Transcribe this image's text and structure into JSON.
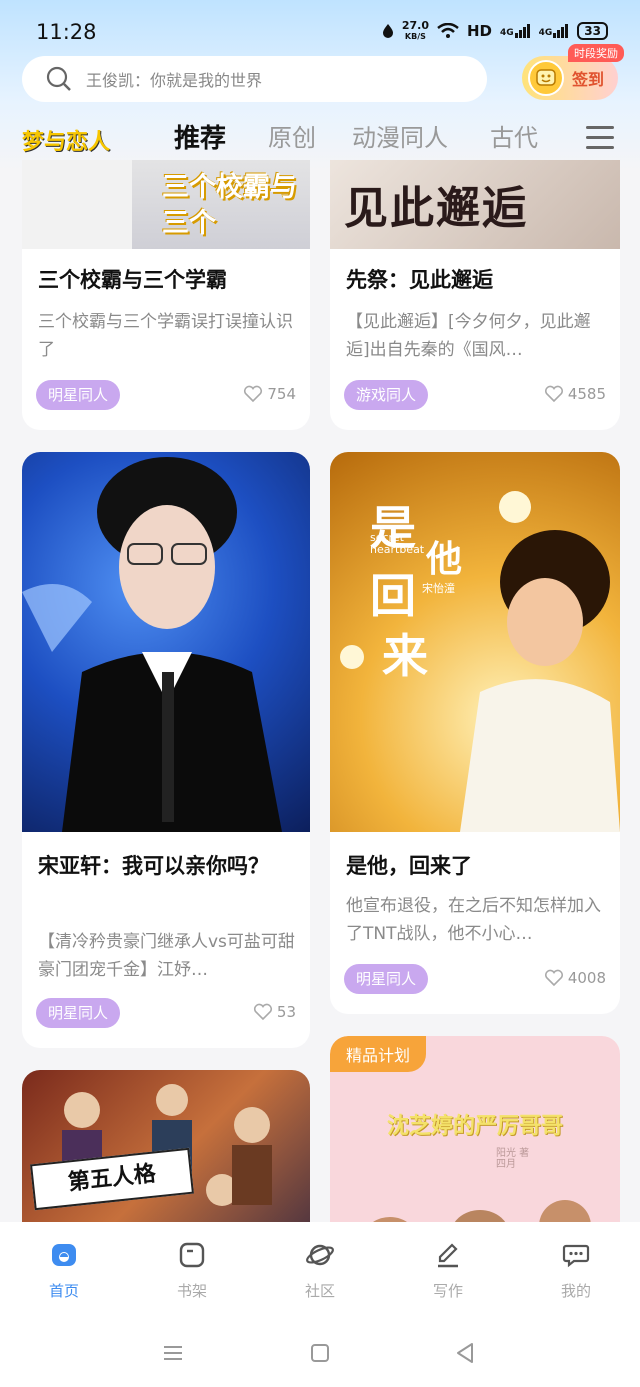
{
  "status": {
    "time": "11:28",
    "net_speed": "27.0",
    "net_unit": "KB/S",
    "hd": "HD",
    "sig1": "4G",
    "sig2": "4G",
    "battery": "33"
  },
  "search": {
    "text": "王俊凯：你就是我的世界"
  },
  "checkin": {
    "label": "签到",
    "reward_tag": "时段奖励"
  },
  "nav": {
    "logo": "梦与恋人",
    "tabs": [
      "推荐",
      "原创",
      "动漫同人",
      "古代"
    ]
  },
  "cards": [
    {
      "cover_text": "三个校霸与三个",
      "title": "三个校霸与三个学霸",
      "desc": "三个校霸与三个学霸误打误撞认识了",
      "tag": "明星同人",
      "likes": "754"
    },
    {
      "cover_text": "见此邂逅",
      "title": "先祭：见此邂逅",
      "desc": "【见此邂逅】[今夕何夕，见此邂逅]出自先秦的《国风…",
      "tag": "游戏同人",
      "likes": "4585"
    },
    {
      "title": "宋亚轩：我可以亲你吗？",
      "desc": "【清冷矜贵豪门继承人vs可盐可甜豪门团宠千金】江妤…",
      "tag": "明星同人",
      "likes": "53"
    },
    {
      "cover_line1": "是",
      "cover_line2": "他",
      "cover_line3": "回",
      "cover_line4": "来",
      "cover_sub1": "secret",
      "cover_sub2": "heartbeat",
      "cover_author": "宋怡潼",
      "title": "是他，回来了",
      "desc": "他宣布退役，在之后不知怎样加入了TNT战队，他不小心…",
      "tag": "明星同人",
      "likes": "4008"
    },
    {
      "cover_text": "第五人格"
    },
    {
      "badge": "精品计划",
      "cover_text": "沈芝婷的严厉哥哥",
      "cover_sub": "阳光 著 四月"
    }
  ],
  "bottom_nav": [
    {
      "label": "首页",
      "icon": "home-icon",
      "active": true
    },
    {
      "label": "书架",
      "icon": "bookshelf-icon",
      "active": false
    },
    {
      "label": "社区",
      "icon": "planet-icon",
      "active": false
    },
    {
      "label": "写作",
      "icon": "pen-icon",
      "active": false
    },
    {
      "label": "我的",
      "icon": "chat-bubble-icon",
      "active": false
    }
  ],
  "colors": {
    "accent": "#3e8cf0",
    "tag": "#c9a8ef",
    "badge": "#f7a43a",
    "logo": "#f7c600"
  }
}
